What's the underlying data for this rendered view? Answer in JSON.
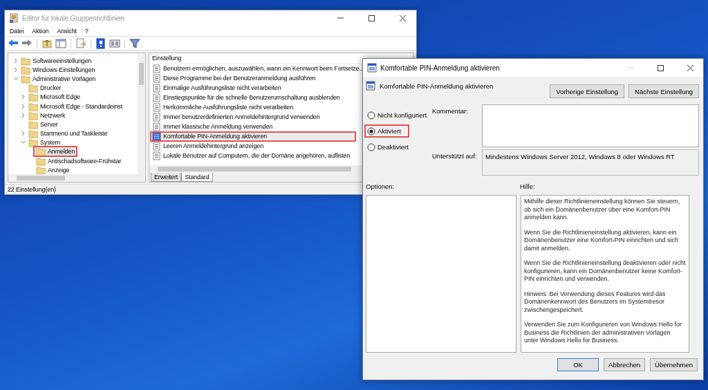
{
  "editor": {
    "title": "Editor für lokale Gruppenrichtlinien",
    "menu": [
      "Datei",
      "Aktion",
      "Ansicht",
      "?"
    ],
    "tree": [
      {
        "label": "Softwareeinstellungen",
        "expanded": false,
        "selected": false
      },
      {
        "label": "Windows-Einstellungen",
        "expanded": false,
        "selected": false
      },
      {
        "label": "Administrative Vorlagen",
        "expanded": true,
        "selected": false,
        "children": [
          {
            "label": "Drucker",
            "selected": false
          },
          {
            "label": "Microsoft Edge",
            "expanded": false,
            "selected": false
          },
          {
            "label": "Microsoft Edge - Standardeinst",
            "expanded": false,
            "selected": false
          },
          {
            "label": "Netzwerk",
            "expanded": false,
            "selected": false
          },
          {
            "label": "Server",
            "selected": false
          },
          {
            "label": "Startmenü und Taskleiste",
            "expanded": false,
            "selected": false
          },
          {
            "label": "System",
            "expanded": true,
            "selected": false,
            "children": [
              {
                "label": "Anmelden",
                "selected": true
              },
              {
                "label": "Antischadsoftware-Frühstar",
                "selected": false
              },
              {
                "label": "Anzeige",
                "selected": false
              }
            ]
          }
        ]
      }
    ],
    "column_header": "Einstellung",
    "settings": [
      {
        "label": "Benutzern ermöglichen, auszuwählen, wann ein Kennwort beim Fortsetze...",
        "selected": false
      },
      {
        "label": "Diese Programme bei der Benutzeranmeldung ausführen",
        "selected": false
      },
      {
        "label": "Einmalige Ausführungsliste nicht verarbeiten",
        "selected": false
      },
      {
        "label": "Einstiegspunkte für die schnelle Benutzerumschaltung ausblenden",
        "selected": false
      },
      {
        "label": "Herkömmliche Ausführungsliste nicht verarbeiten",
        "selected": false
      },
      {
        "label": "Immer benutzerdefinierten Anmeldehintergrund verwenden",
        "selected": false
      },
      {
        "label": "Immer klassische Anmeldung verwenden",
        "selected": false
      },
      {
        "label": "Komfortable PIN-Anmeldung aktivieren",
        "selected": true
      },
      {
        "label": "Leeren Anmeldehintergrund anzeigen",
        "selected": false
      },
      {
        "label": "Lokale Benutzer auf Computern, die der Domäne angehören, auflisten",
        "selected": false
      }
    ],
    "tabs": [
      {
        "label": "Erweitert",
        "selected": false
      },
      {
        "label": "Standard",
        "selected": true
      }
    ],
    "status_bar": "22 Einstellung(en)"
  },
  "dialog": {
    "title": "Komfortable PIN-Anmeldung aktivieren",
    "heading": "Komfortable PIN-Anmeldung aktivieren",
    "nav_buttons": [
      "Vorherige Einstellung",
      "Nächste Einstellung"
    ],
    "options": [
      {
        "label": "Nicht konfiguriert",
        "selected": false
      },
      {
        "label": "Aktiviert",
        "selected": true
      },
      {
        "label": "Deaktiviert",
        "selected": false
      }
    ],
    "comment_label": "Kommentar:",
    "supported_label": "Unterstützt auf:",
    "supported_value": "Mindestens Windows Server 2012, Windows 8 oder Windows RT",
    "options_label": "Optionen:",
    "help_label": "Hilfe:",
    "help": [
      "Mithilfe dieser Richtlinieneinstellung können Sie steuern, ob sich ein Domänenbenutzer über eine Komfort-PIN anmelden kann.",
      "Wenn Sie die Richtlinieneinstellung aktivieren, kann ein Domänenbenutzer eine Komfort-PIN einrichten und sich damit anmelden.",
      "Wenn Sie die Richtlinieneinstellung deaktivieren oder nicht konfigurieren, kann ein Domänenbenutzer keine Komfort-PIN einrichten und verwenden.",
      "Hinweis: Bei Verwendung dieses Features wird das Domänenkennwort des Benutzers im Systemtresor zwischengespeichert.",
      "Verwenden Sie zum Konfigurieren von Windows Hello for Business die Richtlinien der administrativen Vorlagen unter Windows Hello for Business."
    ],
    "buttons": [
      {
        "label": "OK",
        "default": true
      },
      {
        "label": "Abbrechen",
        "default": false
      },
      {
        "label": "Übernehmen",
        "default": false
      }
    ]
  }
}
